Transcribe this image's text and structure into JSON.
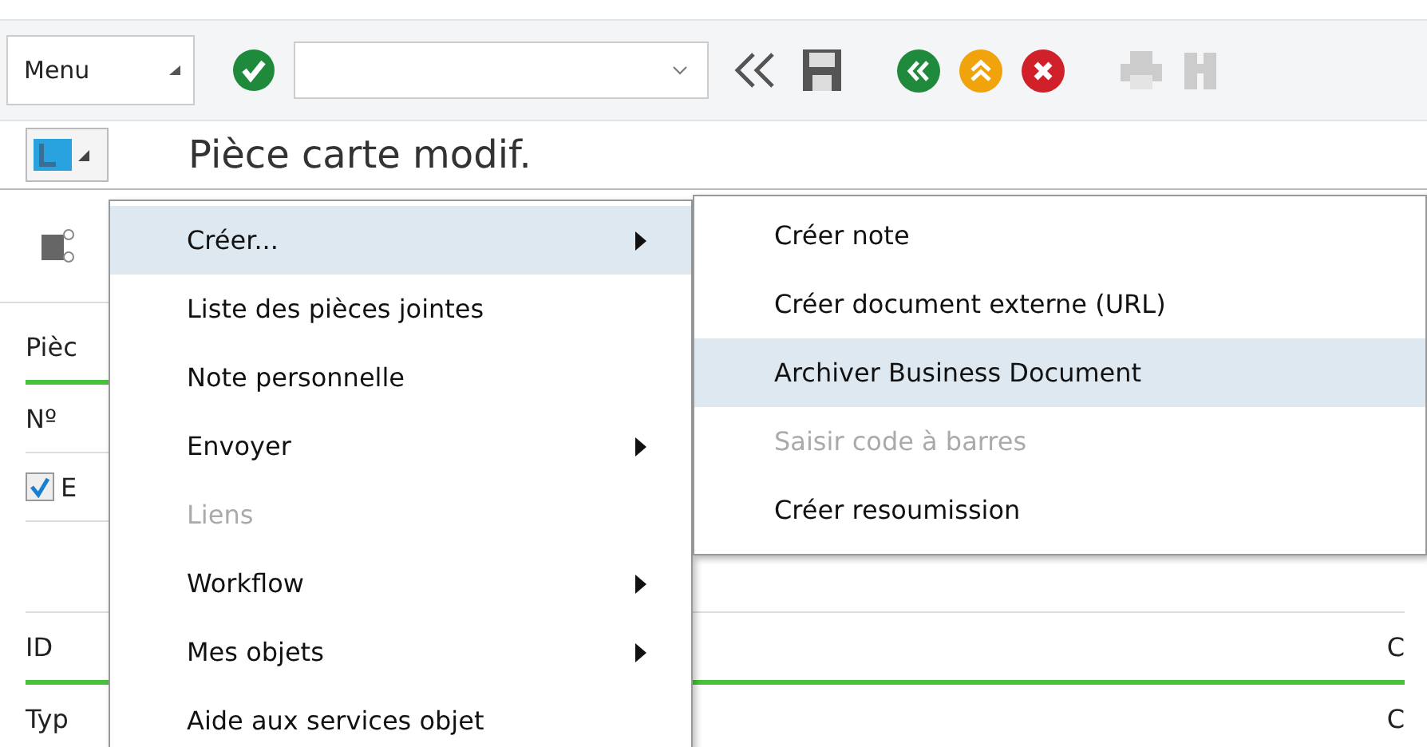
{
  "toolbar": {
    "menu_label": "Menu"
  },
  "title": "Pièce carte modif.",
  "form": {
    "header_labels": [
      "Pièc",
      "Nº"
    ],
    "checkbox": {
      "label": "E",
      "checked": true
    },
    "lower_labels": [
      "ID",
      "Typ"
    ],
    "right_labels": [
      "C",
      "C"
    ]
  },
  "context_menu": [
    {
      "label": "Créer...",
      "submenu": true,
      "disabled": false,
      "selected": true
    },
    {
      "label": "Liste des pièces jointes",
      "submenu": false,
      "disabled": false,
      "selected": false
    },
    {
      "label": "Note personnelle",
      "submenu": false,
      "disabled": false,
      "selected": false
    },
    {
      "label": "Envoyer",
      "submenu": true,
      "disabled": false,
      "selected": false
    },
    {
      "label": "Liens",
      "submenu": false,
      "disabled": true,
      "selected": false
    },
    {
      "label": "Workflow",
      "submenu": true,
      "disabled": false,
      "selected": false
    },
    {
      "label": "Mes objets",
      "submenu": true,
      "disabled": false,
      "selected": false
    },
    {
      "label": "Aide aux services objet",
      "submenu": false,
      "disabled": false,
      "selected": false
    }
  ],
  "submenu": [
    {
      "label": "Créer note",
      "disabled": false,
      "selected": false
    },
    {
      "label": "Créer document externe (URL)",
      "disabled": false,
      "selected": false
    },
    {
      "label": "Archiver Business Document",
      "disabled": false,
      "selected": true
    },
    {
      "label": "Saisir code à barres",
      "disabled": true,
      "selected": false
    },
    {
      "label": "Créer resoumission",
      "disabled": false,
      "selected": false
    }
  ]
}
